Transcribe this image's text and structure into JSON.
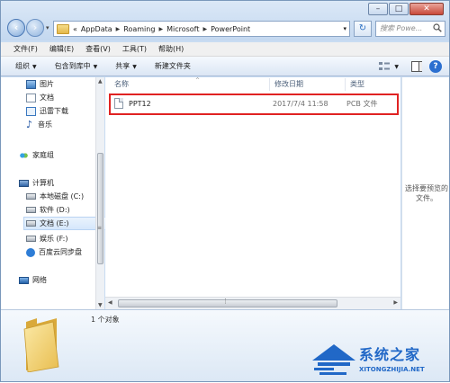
{
  "address": {
    "overflow": "«",
    "crumbs": [
      "AppData",
      "Roaming",
      "Microsoft",
      "PowerPoint"
    ]
  },
  "search": {
    "placeholder": "搜索 Powe..."
  },
  "menu": [
    "文件(F)",
    "编辑(E)",
    "查看(V)",
    "工具(T)",
    "帮助(H)"
  ],
  "toolbar": {
    "organize": "组织",
    "include": "包含到库中",
    "share": "共享",
    "new_folder": "新建文件夹"
  },
  "sidebar": {
    "favorites": [
      "图片",
      "文档",
      "迅雷下载",
      "音乐"
    ],
    "homegroup": "家庭组",
    "computer": "计算机",
    "drives": [
      "本地磁盘 (C:)",
      "软件 (D:)",
      "文档 (E:)",
      "娱乐 (F:)",
      "百度云同步盘"
    ],
    "network": "网络"
  },
  "columns": {
    "name": "名称",
    "date": "修改日期",
    "type": "类型"
  },
  "files": [
    {
      "name": "PPT12",
      "date": "2017/7/4 11:58",
      "type": "PCB 文件"
    }
  ],
  "preview": {
    "text": "选择要预览的文件。"
  },
  "details": {
    "count": "1 个对象"
  },
  "watermark": {
    "title": "系统之家",
    "url": "XITONGZHIJIA.NET"
  },
  "colors": {
    "highlight": "#e02222",
    "accent": "#2168c7"
  }
}
